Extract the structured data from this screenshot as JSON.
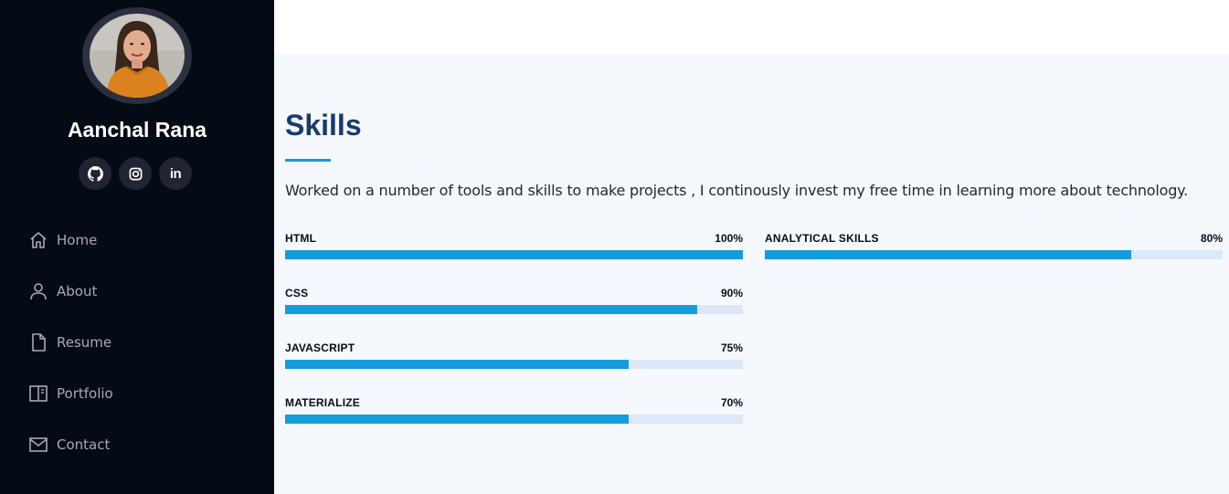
{
  "profile": {
    "name": "Aanchal Rana"
  },
  "social": [
    {
      "icon": "github-icon"
    },
    {
      "icon": "instagram-icon"
    },
    {
      "icon": "linkedin-icon",
      "text": "in"
    }
  ],
  "nav": {
    "items": [
      {
        "label": "Home",
        "icon": "home-icon"
      },
      {
        "label": "About",
        "icon": "user-icon"
      },
      {
        "label": "Resume",
        "icon": "file-icon"
      },
      {
        "label": "Portfolio",
        "icon": "book-icon"
      },
      {
        "label": "Contact",
        "icon": "envelope-icon"
      }
    ]
  },
  "skills": {
    "title": "Skills",
    "description": "Worked on a number of tools and skills to make projects , I continously invest my free time in learning more about technology.",
    "items": [
      {
        "name": "HTML",
        "value": "100%",
        "fill": 1.0
      },
      {
        "name": "CSS",
        "value": "90%",
        "fill": 0.9
      },
      {
        "name": "JAVASCRIPT",
        "value": "75%",
        "fill": 0.75
      },
      {
        "name": "MATERIALIZE",
        "value": "70%",
        "fill": 0.75
      },
      {
        "name": "ANALYTICAL SKILLS",
        "value": "80%",
        "fill": 0.8
      }
    ]
  },
  "colors": {
    "sidebar_bg": "#040b14",
    "accent": "#149ddd",
    "title": "#173b6c",
    "track": "#dce8f8"
  }
}
